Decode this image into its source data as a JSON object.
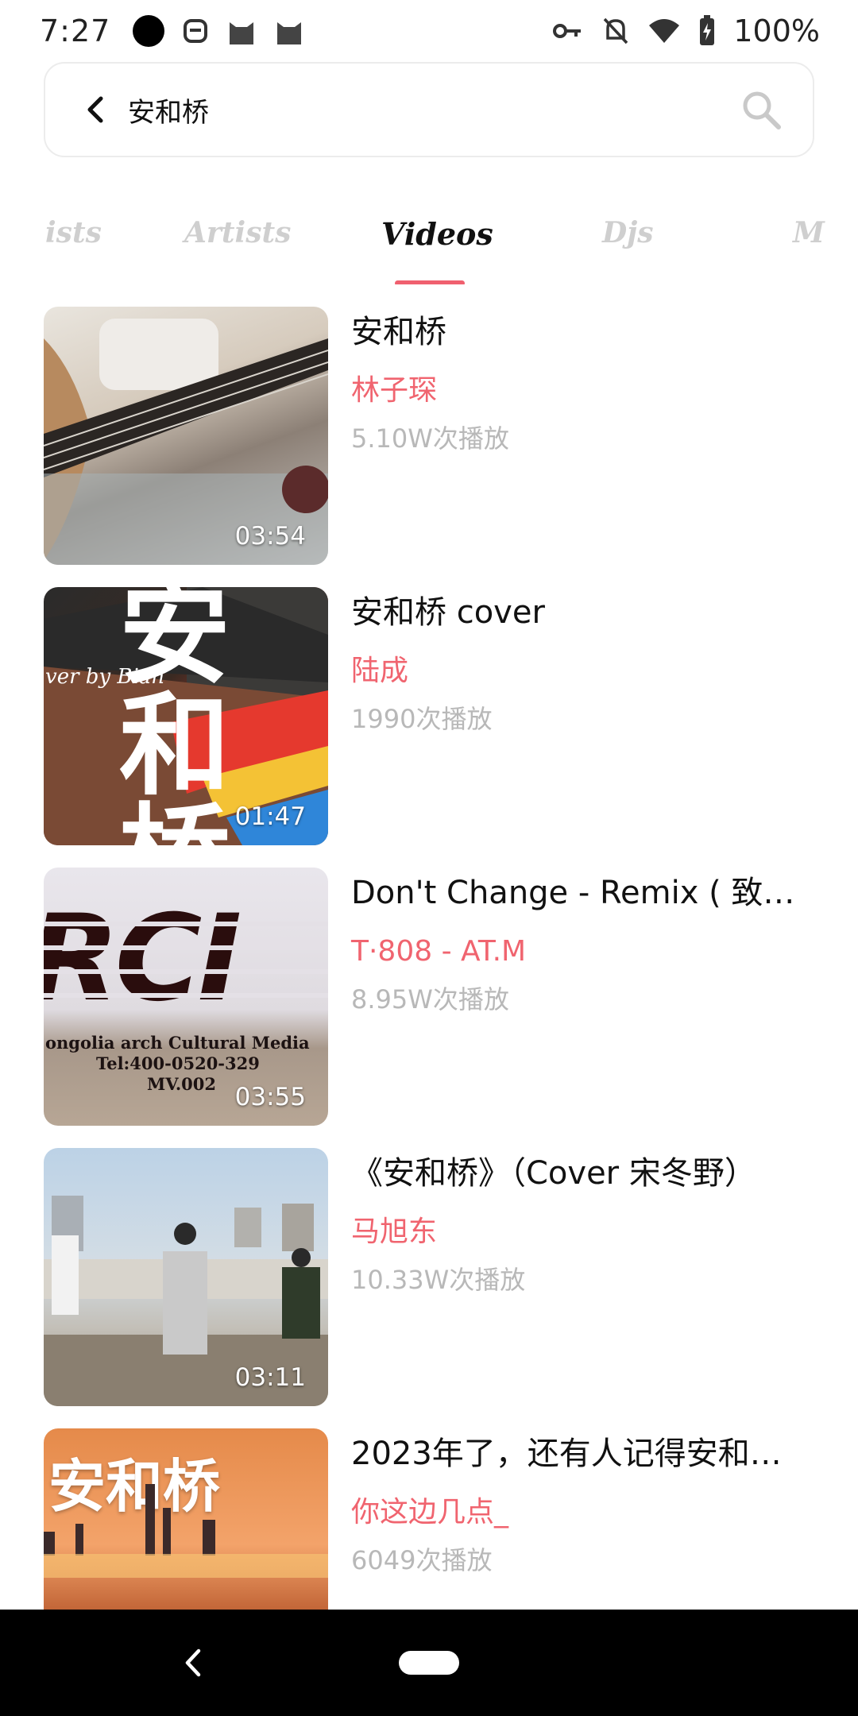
{
  "status_bar": {
    "time": "7:27",
    "battery_percent": "100%",
    "icons_left": [
      "circle-notification-icon",
      "face-icon",
      "cat-icon",
      "cat-icon"
    ],
    "icons_right": [
      "key-icon",
      "bell-off-icon",
      "wifi-icon",
      "battery-charging-icon"
    ]
  },
  "search": {
    "query": "安和桥",
    "back_icon": "chevron-left-icon",
    "search_icon": "search-icon"
  },
  "tabs": [
    {
      "label": "ists"
    },
    {
      "label": "Artists"
    },
    {
      "label": "Videos",
      "active": true
    },
    {
      "label": "Djs"
    },
    {
      "label": "M"
    }
  ],
  "videos": [
    {
      "title": "安和桥",
      "artist": "林子琛",
      "plays": "5.10W次播放",
      "duration": "03:54"
    },
    {
      "title": "安和桥 cover",
      "artist": "陆成",
      "plays": "1990次播放",
      "duration": "01:47"
    },
    {
      "title": "Don't Change - Remix ( 致敬…",
      "artist": "T·808 - AT.M",
      "plays": "8.95W次播放",
      "duration": "03:55"
    },
    {
      "title": "《安和桥》（Cover 宋冬野）",
      "artist": "马旭东",
      "plays": "10.33W次播放",
      "duration": "03:11"
    },
    {
      "title": "2023年了，还有人记得安和…",
      "artist": "你这边几点_",
      "plays": "6049次播放",
      "duration": ""
    }
  ],
  "thumb_text": {
    "v2_art": "安和桥",
    "v2_caption": "ver by Bian",
    "v3_banner": "RCI",
    "v3_line1": "ongolia arch Cultural Media",
    "v3_line2": "Tel:400-0520-329",
    "v3_line3": "MV.002",
    "v5_art": "安和桥"
  },
  "accent_color": "#f0646f",
  "nav_bar": {
    "back_icon": "nav-back-icon",
    "home_icon": "nav-home-pill"
  }
}
